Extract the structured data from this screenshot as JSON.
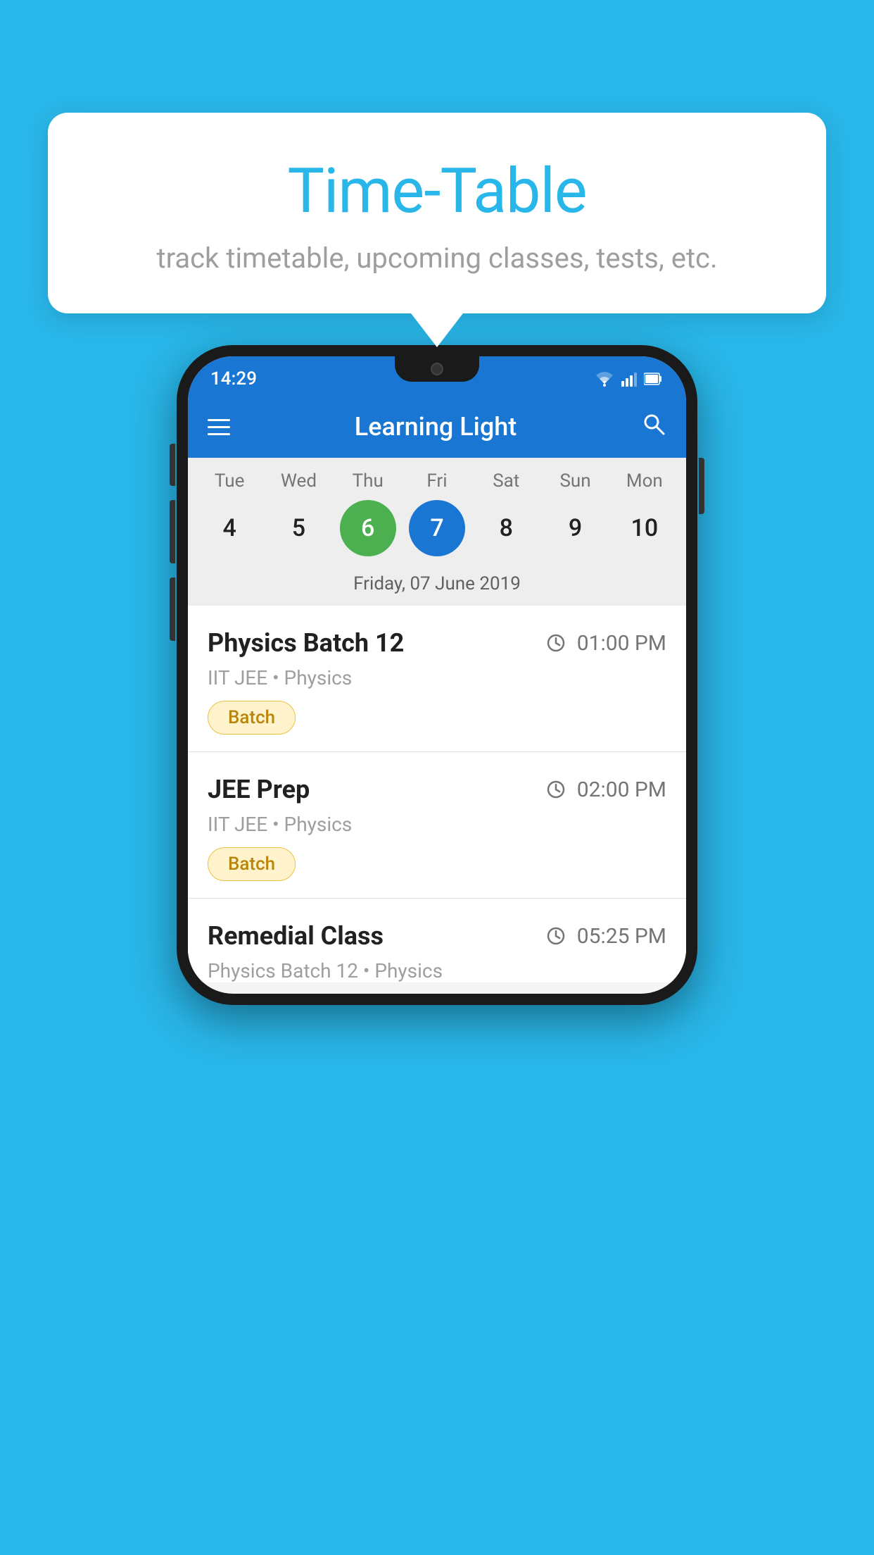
{
  "background_color": "#29b6e8",
  "tooltip": {
    "title": "Time-Table",
    "subtitle": "track timetable, upcoming classes, tests, etc."
  },
  "status_bar": {
    "time": "14:29"
  },
  "app_bar": {
    "title": "Learning Light",
    "menu_icon": "hamburger-icon",
    "search_icon": "search-icon"
  },
  "calendar": {
    "selected_date_label": "Friday, 07 June 2019",
    "days": [
      {
        "name": "Tue",
        "num": "4",
        "state": "normal"
      },
      {
        "name": "Wed",
        "num": "5",
        "state": "normal"
      },
      {
        "name": "Thu",
        "num": "6",
        "state": "today"
      },
      {
        "name": "Fri",
        "num": "7",
        "state": "selected"
      },
      {
        "name": "Sat",
        "num": "8",
        "state": "normal"
      },
      {
        "name": "Sun",
        "num": "9",
        "state": "normal"
      },
      {
        "name": "Mon",
        "num": "10",
        "state": "normal"
      }
    ]
  },
  "schedule": [
    {
      "title": "Physics Batch 12",
      "time": "01:00 PM",
      "subtitle": "IIT JEE • Physics",
      "badge": "Batch"
    },
    {
      "title": "JEE Prep",
      "time": "02:00 PM",
      "subtitle": "IIT JEE • Physics",
      "badge": "Batch"
    },
    {
      "title": "Remedial Class",
      "time": "05:25 PM",
      "subtitle": "Physics Batch 12 • Physics",
      "badge": null
    }
  ]
}
